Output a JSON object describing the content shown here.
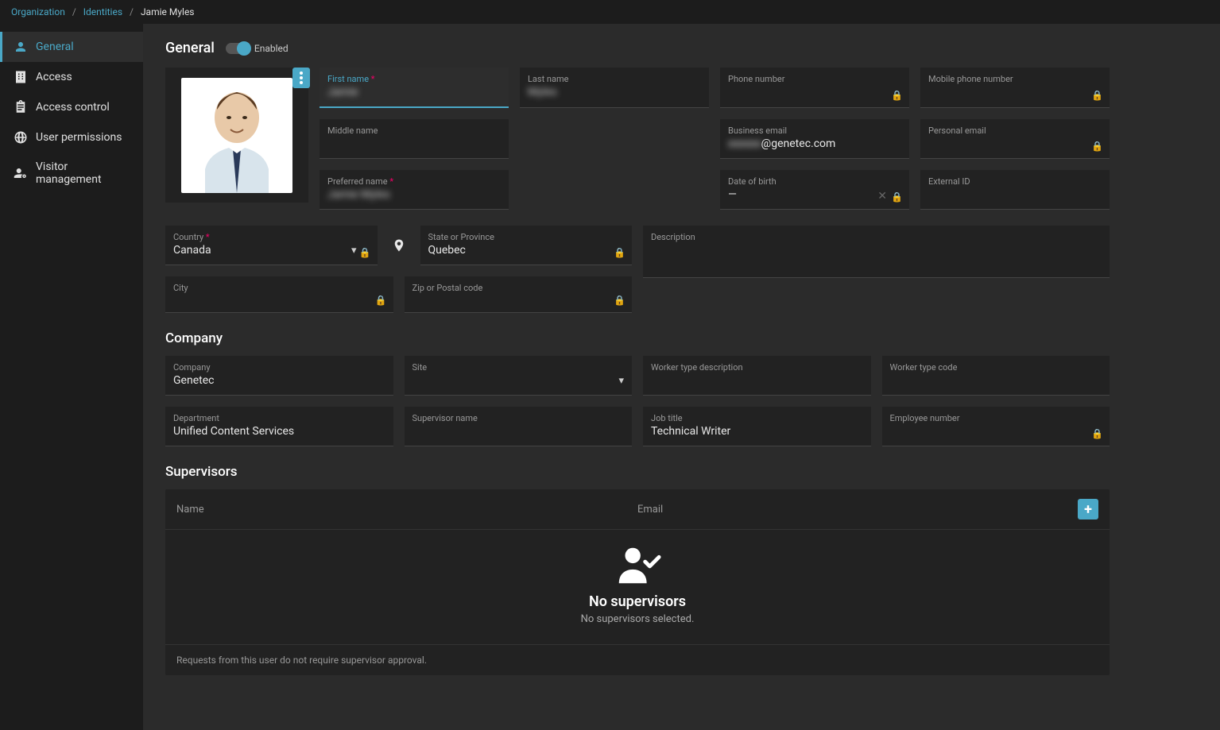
{
  "breadcrumb": {
    "org": "Organization",
    "identities": "Identities",
    "current": "Jamie Myles"
  },
  "sidebar": {
    "general": "General",
    "access": "Access",
    "access_control": "Access control",
    "user_permissions": "User permissions",
    "visitor_management": "Visitor management"
  },
  "general": {
    "title": "General",
    "enabled_label": "Enabled",
    "labels": {
      "first_name": "First name",
      "last_name": "Last name",
      "phone": "Phone number",
      "mobile": "Mobile phone number",
      "middle": "Middle name",
      "business_email": "Business email",
      "personal_email": "Personal email",
      "preferred": "Preferred name",
      "dob": "Date of birth",
      "external_id": "External ID",
      "country": "Country",
      "state": "State or Province",
      "description": "Description",
      "city": "City",
      "zip": "Zip or Postal code"
    },
    "values": {
      "first_name": "Jamie",
      "last_name": "Myles",
      "business_email_visible": "@genetec.com",
      "business_email_hidden": "xxxxxx",
      "preferred": "Jamie Myles",
      "dob": "—",
      "country": "Canada",
      "state": "Quebec"
    }
  },
  "company": {
    "title": "Company",
    "labels": {
      "company": "Company",
      "site": "Site",
      "worker_desc": "Worker type description",
      "worker_code": "Worker type code",
      "department": "Department",
      "supervisor": "Supervisor name",
      "job_title": "Job title",
      "employee_no": "Employee number"
    },
    "values": {
      "company": "Genetec",
      "department": "Unified Content Services",
      "job_title": "Technical Writer"
    }
  },
  "supervisors": {
    "title": "Supervisors",
    "col_name": "Name",
    "col_email": "Email",
    "empty_title": "No supervisors",
    "empty_sub": "No supervisors selected.",
    "footer": "Requests from this user do not require supervisor approval."
  }
}
